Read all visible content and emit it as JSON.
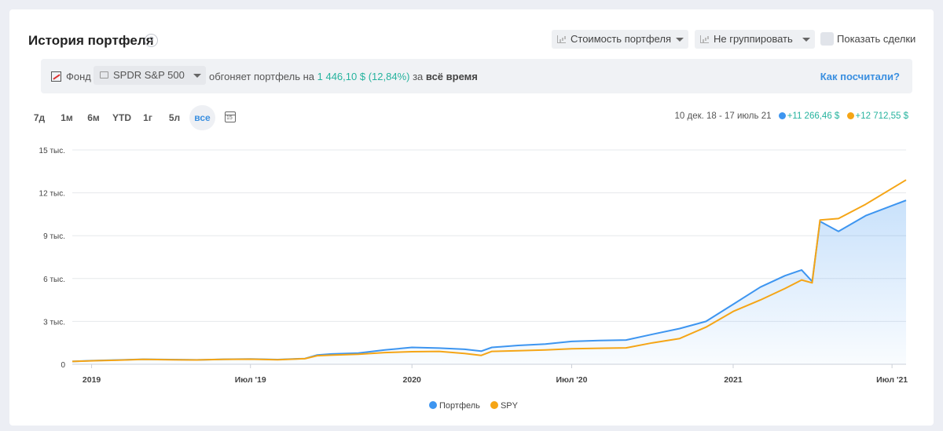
{
  "header": {
    "title": "История портфеля",
    "help": "?",
    "metric_select": "Стоимость портфеля",
    "group_select": "Не группировать",
    "show_trades_label": "Показать сделки"
  },
  "comparison": {
    "fund_label": "Фонд",
    "fund_value": "SPDR S&P 500",
    "text_before": "обгоняет портфель на",
    "amount": "1 446,10 $",
    "percent": "(12,84%)",
    "text_mid": "за",
    "period": "всё время",
    "how_link": "Как посчитали?"
  },
  "periods": [
    "7д",
    "1м",
    "6м",
    "YTD",
    "1г",
    "5л",
    "все"
  ],
  "active_period": "все",
  "range": {
    "dates": "10 дек. 18 - 17 июль 21",
    "portfolio_gain": "+11 266,46 $",
    "spy_gain": "+12 712,55 $"
  },
  "colors": {
    "portfolio": "#3d95f0",
    "spy": "#f5a516",
    "gain_text": "#26b39e",
    "accent": "#3a8fe0"
  },
  "chart_data": {
    "type": "line",
    "x": [
      "2018-12-10",
      "2019-01-01",
      "2019-02-01",
      "2019-03-01",
      "2019-04-01",
      "2019-05-01",
      "2019-06-01",
      "2019-07-01",
      "2019-08-01",
      "2019-09-01",
      "2019-09-15",
      "2019-10-01",
      "2019-11-01",
      "2019-12-01",
      "2020-01-01",
      "2020-02-01",
      "2020-03-01",
      "2020-03-20",
      "2020-04-01",
      "2020-05-01",
      "2020-06-01",
      "2020-07-01",
      "2020-08-01",
      "2020-09-01",
      "2020-10-01",
      "2020-11-01",
      "2020-12-01",
      "2021-01-01",
      "2021-02-01",
      "2021-03-01",
      "2021-03-20",
      "2021-04-01",
      "2021-04-10",
      "2021-05-01",
      "2021-06-01",
      "2021-07-17"
    ],
    "series": [
      {
        "name": "Портфель",
        "values": [
          200,
          250,
          300,
          350,
          330,
          310,
          350,
          370,
          330,
          400,
          650,
          720,
          780,
          1000,
          1180,
          1130,
          1050,
          920,
          1180,
          1320,
          1420,
          1600,
          1660,
          1700,
          2100,
          2500,
          3000,
          4200,
          5400,
          6200,
          6600,
          5800,
          10000,
          9300,
          10400,
          11470
        ]
      },
      {
        "name": "SPY",
        "values": [
          200,
          240,
          290,
          340,
          320,
          300,
          340,
          355,
          320,
          390,
          600,
          640,
          700,
          820,
          880,
          900,
          760,
          620,
          900,
          950,
          1000,
          1080,
          1120,
          1150,
          1500,
          1800,
          2600,
          3700,
          4500,
          5300,
          5900,
          5700,
          10100,
          10200,
          11200,
          12900
        ]
      }
    ],
    "xaxis_ticks": [
      "2019",
      "Июл '19",
      "2020",
      "Июл '20",
      "2021",
      "Июл '21"
    ],
    "xaxis_tick_dates": [
      "2019-01-01",
      "2019-07-01",
      "2020-01-01",
      "2020-07-01",
      "2021-01-01",
      "2021-07-01"
    ],
    "yaxis_ticks": [
      "0",
      "3 тыс.",
      "6 тыс.",
      "9 тыс.",
      "12 тыс.",
      "15 тыс."
    ],
    "yaxis_tick_values": [
      0,
      3000,
      6000,
      9000,
      12000,
      15000
    ],
    "ylim": [
      0,
      15000
    ],
    "xlim": [
      "2018-12-10",
      "2021-07-17"
    ],
    "grid": true,
    "legend": "bottom",
    "area_fill_series": "Портфель"
  }
}
